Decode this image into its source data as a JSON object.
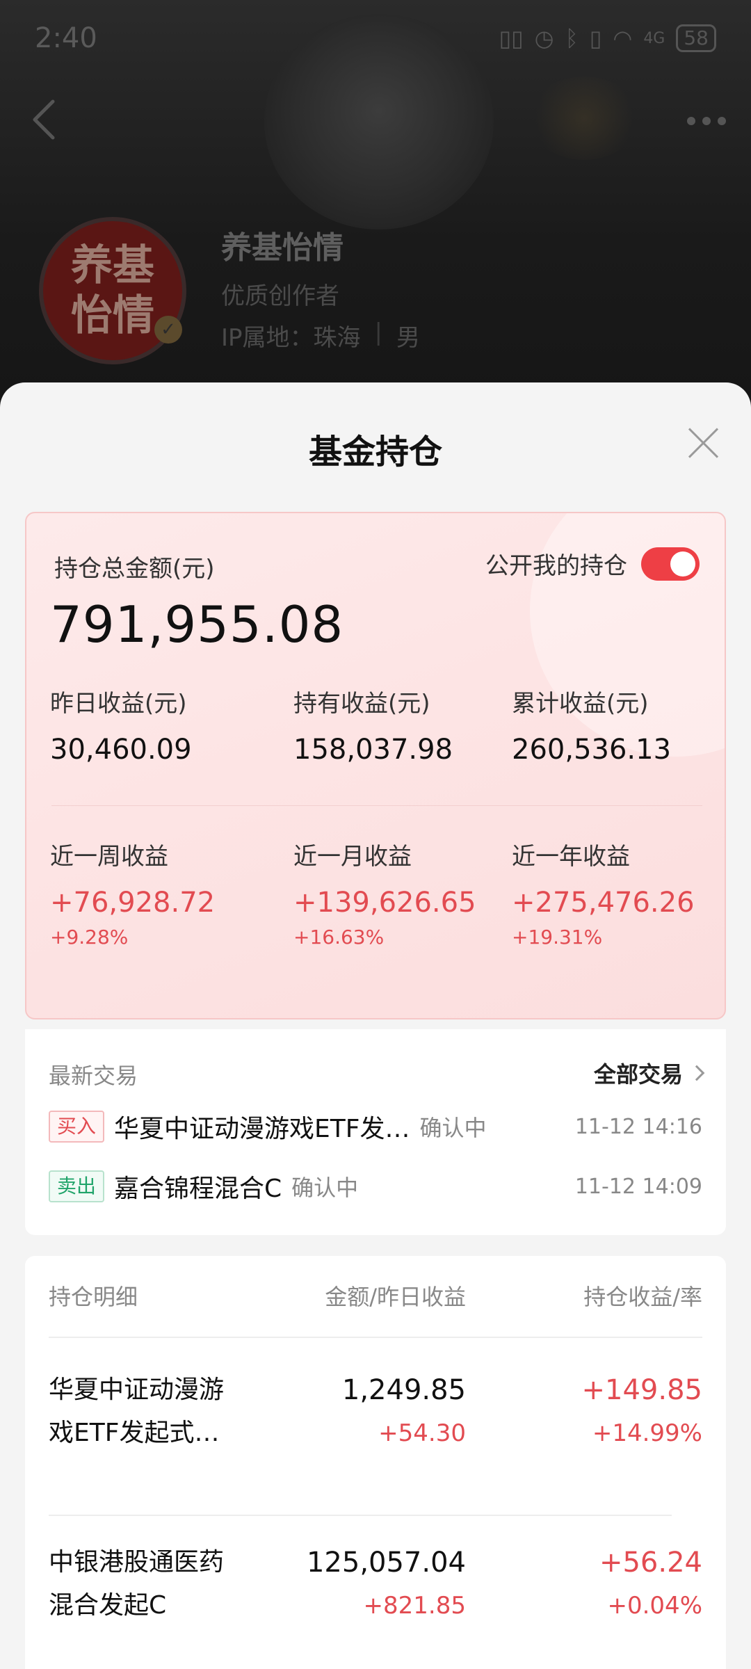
{
  "status_bar": {
    "time": "2:40",
    "signal": "4G",
    "battery": "58"
  },
  "profile": {
    "avatar_text_line1": "养基",
    "avatar_text_line2": "怡情",
    "name": "养基怡情",
    "role": "优质创作者",
    "ip_label": "IP属地：珠海",
    "gender": "男"
  },
  "sheet": {
    "title": "基金持仓"
  },
  "summary": {
    "total_label": "持仓总金额(元)",
    "public_label": "公开我的持仓",
    "public_on": true,
    "total_value": "791,955.08",
    "row1": [
      {
        "label": "昨日收益(元)",
        "value": "30,460.09"
      },
      {
        "label": "持有收益(元)",
        "value": "158,037.98"
      },
      {
        "label": "累计收益(元)",
        "value": "260,536.13"
      }
    ],
    "row2": [
      {
        "label": "近一周收益",
        "value": "+76,928.72",
        "pct": "+9.28%"
      },
      {
        "label": "近一月收益",
        "value": "+139,626.65",
        "pct": "+16.63%"
      },
      {
        "label": "近一年收益",
        "value": "+275,476.26",
        "pct": "+19.31%"
      }
    ]
  },
  "trades": {
    "title": "最新交易",
    "all_label": "全部交易",
    "items": [
      {
        "tag": "买入",
        "name": "华夏中证动漫游戏ETF发…",
        "status": "确认中",
        "time": "11-12 14:16"
      },
      {
        "tag": "卖出",
        "name": "嘉合锦程混合C",
        "status": "确认中",
        "time": "11-12 14:09"
      }
    ]
  },
  "holdings": {
    "header": {
      "col1": "持仓明细",
      "col2": "金额/昨日收益",
      "col3": "持仓收益/率"
    },
    "rows": [
      {
        "name_line1": "华夏中证动漫游",
        "name_line2": "戏ETF发起式…",
        "amount": "1,249.85",
        "yesterday": "+54.30",
        "profit": "+149.85",
        "rate": "+14.99%"
      },
      {
        "name_line1": "中银港股通医药",
        "name_line2": "混合发起C",
        "amount": "125,057.04",
        "yesterday": "+821.85",
        "profit": "+56.24",
        "rate": "+0.04%"
      }
    ]
  },
  "colors": {
    "accent_red": "#e24b51",
    "toggle_red": "#ee3f45",
    "sell_green": "#20a46a"
  }
}
